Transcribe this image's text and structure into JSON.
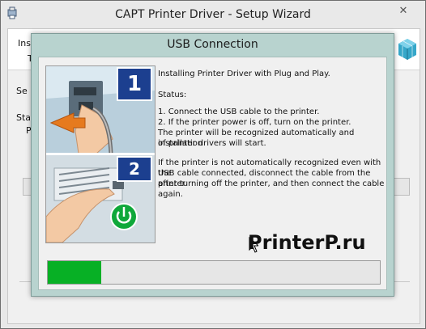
{
  "outer_window": {
    "title": "CAPT Printer Driver - Setup Wizard",
    "close_label": "✕",
    "ghost_labels": [
      "Inst",
      "T",
      "Se",
      "Sta",
      "P"
    ]
  },
  "dialog": {
    "title": "USB Connection",
    "step_badges": [
      "1",
      "2"
    ],
    "intro": "Installing Printer Driver with Plug and Play.",
    "status_label": "Status:",
    "status_lines": [
      "1. Connect the USB cable to the printer.",
      "2. If the printer power is off, turn on the printer.",
      "The printer will be recognized automatically and installation",
      "of printer drivers will start."
    ],
    "note_lines": [
      "If the printer is not automatically recognized even with the",
      "USB cable connected, disconnect the cable from the printer",
      "after turning off the printer, and then connect the cable",
      "again."
    ],
    "progress_percent": 16
  },
  "watermark": "PrinterP.ru",
  "colors": {
    "progress_fill": "#07b025",
    "dialog_frame": "#b8d3cf",
    "badge_blue": "#1c3f8f",
    "power_green": "#0fa83a"
  }
}
